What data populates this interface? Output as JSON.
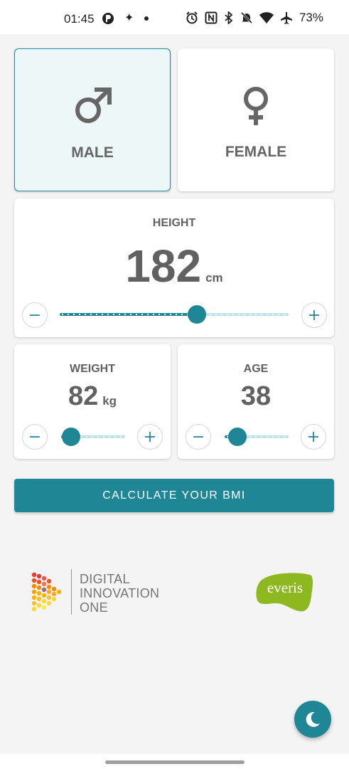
{
  "status_bar": {
    "time": "01:45",
    "battery": "73%",
    "icons": [
      "app-notification-icon",
      "sparkle-icon",
      "dot-icon",
      "alarm-icon",
      "nfc-icon",
      "bluetooth-icon",
      "mute-icon",
      "wifi-icon",
      "airplane-icon"
    ]
  },
  "gender": {
    "male_label": "MALE",
    "female_label": "FEMALE",
    "selected": "male"
  },
  "height": {
    "title": "HEIGHT",
    "value": "182",
    "unit": "cm",
    "slider_level": 0.6,
    "minus": "−",
    "plus": "+"
  },
  "weight": {
    "title": "WEIGHT",
    "value": "82",
    "unit": "kg",
    "slider_level": 0.15,
    "minus": "−",
    "plus": "+"
  },
  "age": {
    "title": "AGE",
    "value": "38",
    "slider_level": 0.2,
    "minus": "−",
    "plus": "+"
  },
  "actions": {
    "calculate_label": "CALCULATE YOUR BMI"
  },
  "logos": {
    "dio_line1": "DIGITAL",
    "dio_line2": "INNOVATION",
    "dio_line3": "ONE",
    "everis": "everis"
  },
  "colors": {
    "accent": "#1f8696",
    "selected_bg": "#eef7f8",
    "everis_green": "#8db820"
  }
}
